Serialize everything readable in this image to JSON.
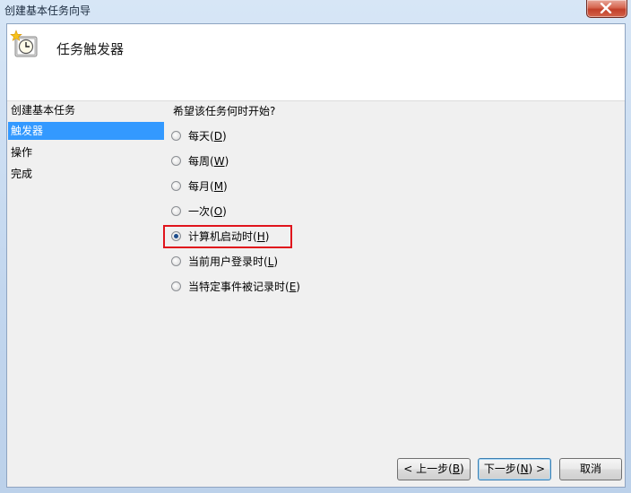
{
  "window": {
    "title": "创建基本任务向导"
  },
  "header": {
    "title": "任务触发器",
    "icon": "clock-icon"
  },
  "steps": [
    {
      "label": "创建基本任务",
      "active": false
    },
    {
      "label": "触发器",
      "active": true
    },
    {
      "label": "操作",
      "active": false
    },
    {
      "label": "完成",
      "active": false
    }
  ],
  "question": "希望该任务何时开始?",
  "options": [
    {
      "label": "每天(",
      "key": "D",
      "end": ")",
      "checked": false
    },
    {
      "label": "每周(",
      "key": "W",
      "end": ")",
      "checked": false
    },
    {
      "label": "每月(",
      "key": "M",
      "end": ")",
      "checked": false
    },
    {
      "label": "一次(",
      "key": "O",
      "end": ")",
      "checked": false
    },
    {
      "label": "计算机启动时(",
      "key": "H",
      "end": ")",
      "checked": true
    },
    {
      "label": "当前用户登录时(",
      "key": "L",
      "end": ")",
      "checked": false
    },
    {
      "label": "当特定事件被记录时(",
      "key": "E",
      "end": ")",
      "checked": false
    }
  ],
  "buttons": {
    "back": {
      "pre": "< 上一步(",
      "key": "B",
      "post": ")"
    },
    "next": {
      "pre": "下一步(",
      "key": "N",
      "post": ") >"
    },
    "cancel": {
      "label": "取消"
    }
  },
  "colors": {
    "highlight_border": "#e0141c",
    "selected_step": "#3399ff"
  }
}
